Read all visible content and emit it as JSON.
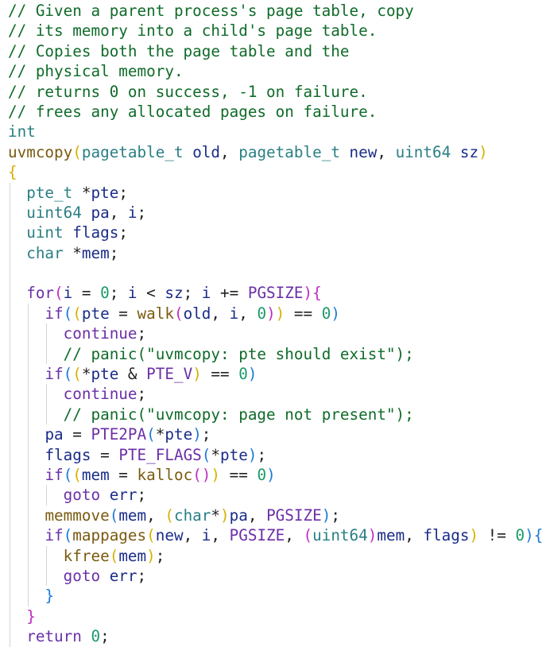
{
  "code": {
    "lines": [
      {
        "indent": 0,
        "guides": [],
        "tokens": [
          [
            "cm",
            "// Given a parent process's page table, copy"
          ]
        ]
      },
      {
        "indent": 0,
        "guides": [],
        "tokens": [
          [
            "cm",
            "// its memory into a child's page table."
          ]
        ]
      },
      {
        "indent": 0,
        "guides": [],
        "tokens": [
          [
            "cm",
            "// Copies both the page table and the"
          ]
        ]
      },
      {
        "indent": 0,
        "guides": [],
        "tokens": [
          [
            "cm",
            "// physical memory."
          ]
        ]
      },
      {
        "indent": 0,
        "guides": [],
        "tokens": [
          [
            "cm",
            "// returns 0 on success, -1 on failure."
          ]
        ]
      },
      {
        "indent": 0,
        "guides": [],
        "tokens": [
          [
            "cm",
            "// frees any allocated pages on failure."
          ]
        ]
      },
      {
        "indent": 0,
        "guides": [],
        "tokens": [
          [
            "ty",
            "int"
          ]
        ]
      },
      {
        "indent": 0,
        "guides": [],
        "tokens": [
          [
            "fn",
            "uvmcopy"
          ],
          [
            "b1",
            "("
          ],
          [
            "ty",
            "pagetable_t"
          ],
          [
            "op",
            " "
          ],
          [
            "var",
            "old"
          ],
          [
            "op",
            ", "
          ],
          [
            "ty",
            "pagetable_t"
          ],
          [
            "op",
            " "
          ],
          [
            "var",
            "new"
          ],
          [
            "op",
            ", "
          ],
          [
            "ty",
            "uint64"
          ],
          [
            "op",
            " "
          ],
          [
            "var",
            "sz"
          ],
          [
            "b1",
            ")"
          ]
        ]
      },
      {
        "indent": 0,
        "guides": [],
        "tokens": [
          [
            "b1",
            "{"
          ]
        ]
      },
      {
        "indent": 2,
        "guides": [
          0
        ],
        "tokens": [
          [
            "ty",
            "pte_t"
          ],
          [
            "op",
            " *"
          ],
          [
            "var",
            "pte"
          ],
          [
            "op",
            ";"
          ]
        ]
      },
      {
        "indent": 2,
        "guides": [
          0
        ],
        "tokens": [
          [
            "ty",
            "uint64"
          ],
          [
            "op",
            " "
          ],
          [
            "var",
            "pa"
          ],
          [
            "op",
            ", "
          ],
          [
            "var",
            "i"
          ],
          [
            "op",
            ";"
          ]
        ]
      },
      {
        "indent": 2,
        "guides": [
          0
        ],
        "tokens": [
          [
            "ty",
            "uint"
          ],
          [
            "op",
            " "
          ],
          [
            "var",
            "flags"
          ],
          [
            "op",
            ";"
          ]
        ]
      },
      {
        "indent": 2,
        "guides": [
          0
        ],
        "tokens": [
          [
            "ty",
            "char"
          ],
          [
            "op",
            " *"
          ],
          [
            "var",
            "mem"
          ],
          [
            "op",
            ";"
          ]
        ]
      },
      {
        "indent": 0,
        "guides": [
          0
        ],
        "tokens": []
      },
      {
        "indent": 2,
        "guides": [
          0
        ],
        "tokens": [
          [
            "kw",
            "for"
          ],
          [
            "b2",
            "("
          ],
          [
            "var",
            "i"
          ],
          [
            "op",
            " = "
          ],
          [
            "num",
            "0"
          ],
          [
            "op",
            "; "
          ],
          [
            "var",
            "i"
          ],
          [
            "op",
            " < "
          ],
          [
            "var",
            "sz"
          ],
          [
            "op",
            "; "
          ],
          [
            "var",
            "i"
          ],
          [
            "op",
            " += "
          ],
          [
            "mac",
            "PGSIZE"
          ],
          [
            "b2",
            ")"
          ],
          [
            "b2",
            "{"
          ]
        ]
      },
      {
        "indent": 4,
        "guides": [
          0,
          2
        ],
        "tokens": [
          [
            "kw",
            "if"
          ],
          [
            "b3",
            "("
          ],
          [
            "b1",
            "("
          ],
          [
            "var",
            "pte"
          ],
          [
            "op",
            " = "
          ],
          [
            "fn",
            "walk"
          ],
          [
            "b2",
            "("
          ],
          [
            "var",
            "old"
          ],
          [
            "op",
            ", "
          ],
          [
            "var",
            "i"
          ],
          [
            "op",
            ", "
          ],
          [
            "num",
            "0"
          ],
          [
            "b2",
            ")"
          ],
          [
            "b1",
            ")"
          ],
          [
            "op",
            " == "
          ],
          [
            "num",
            "0"
          ],
          [
            "b3",
            ")"
          ]
        ]
      },
      {
        "indent": 6,
        "guides": [
          0,
          2,
          4
        ],
        "tokens": [
          [
            "kw",
            "continue"
          ],
          [
            "op",
            ";"
          ]
        ]
      },
      {
        "indent": 6,
        "guides": [
          0,
          2,
          4
        ],
        "tokens": [
          [
            "cm",
            "// panic(\"uvmcopy: pte should exist\");"
          ]
        ]
      },
      {
        "indent": 4,
        "guides": [
          0,
          2
        ],
        "tokens": [
          [
            "kw",
            "if"
          ],
          [
            "b3",
            "("
          ],
          [
            "b1",
            "("
          ],
          [
            "op",
            "*"
          ],
          [
            "var",
            "pte"
          ],
          [
            "op",
            " & "
          ],
          [
            "mac",
            "PTE_V"
          ],
          [
            "b1",
            ")"
          ],
          [
            "op",
            " == "
          ],
          [
            "num",
            "0"
          ],
          [
            "b3",
            ")"
          ]
        ]
      },
      {
        "indent": 6,
        "guides": [
          0,
          2,
          4
        ],
        "tokens": [
          [
            "kw",
            "continue"
          ],
          [
            "op",
            ";"
          ]
        ]
      },
      {
        "indent": 6,
        "guides": [
          0,
          2,
          4
        ],
        "tokens": [
          [
            "cm",
            "// panic(\"uvmcopy: page not present\");"
          ]
        ]
      },
      {
        "indent": 4,
        "guides": [
          0,
          2
        ],
        "tokens": [
          [
            "var",
            "pa"
          ],
          [
            "op",
            " = "
          ],
          [
            "mac",
            "PTE2PA"
          ],
          [
            "b3",
            "("
          ],
          [
            "op",
            "*"
          ],
          [
            "var",
            "pte"
          ],
          [
            "b3",
            ")"
          ],
          [
            "op",
            ";"
          ]
        ]
      },
      {
        "indent": 4,
        "guides": [
          0,
          2
        ],
        "tokens": [
          [
            "var",
            "flags"
          ],
          [
            "op",
            " = "
          ],
          [
            "mac",
            "PTE_FLAGS"
          ],
          [
            "b3",
            "("
          ],
          [
            "op",
            "*"
          ],
          [
            "var",
            "pte"
          ],
          [
            "b3",
            ")"
          ],
          [
            "op",
            ";"
          ]
        ]
      },
      {
        "indent": 4,
        "guides": [
          0,
          2
        ],
        "tokens": [
          [
            "kw",
            "if"
          ],
          [
            "b3",
            "("
          ],
          [
            "b1",
            "("
          ],
          [
            "var",
            "mem"
          ],
          [
            "op",
            " = "
          ],
          [
            "fn",
            "kalloc"
          ],
          [
            "b2",
            "()"
          ],
          [
            "b1",
            ")"
          ],
          [
            "op",
            " == "
          ],
          [
            "num",
            "0"
          ],
          [
            "b3",
            ")"
          ]
        ]
      },
      {
        "indent": 6,
        "guides": [
          0,
          2,
          4
        ],
        "tokens": [
          [
            "kw",
            "goto"
          ],
          [
            "op",
            " "
          ],
          [
            "var",
            "err"
          ],
          [
            "op",
            ";"
          ]
        ]
      },
      {
        "indent": 4,
        "guides": [
          0,
          2
        ],
        "tokens": [
          [
            "fn",
            "memmove"
          ],
          [
            "b3",
            "("
          ],
          [
            "var",
            "mem"
          ],
          [
            "op",
            ", "
          ],
          [
            "b1",
            "("
          ],
          [
            "ty",
            "char"
          ],
          [
            "op",
            "*"
          ],
          [
            "b1",
            ")"
          ],
          [
            "var",
            "pa"
          ],
          [
            "op",
            ", "
          ],
          [
            "mac",
            "PGSIZE"
          ],
          [
            "b3",
            ")"
          ],
          [
            "op",
            ";"
          ]
        ]
      },
      {
        "indent": 4,
        "guides": [
          0,
          2
        ],
        "tokens": [
          [
            "kw",
            "if"
          ],
          [
            "b3",
            "("
          ],
          [
            "fn",
            "mappages"
          ],
          [
            "b1",
            "("
          ],
          [
            "var",
            "new"
          ],
          [
            "op",
            ", "
          ],
          [
            "var",
            "i"
          ],
          [
            "op",
            ", "
          ],
          [
            "mac",
            "PGSIZE"
          ],
          [
            "op",
            ", "
          ],
          [
            "b2",
            "("
          ],
          [
            "ty",
            "uint64"
          ],
          [
            "b2",
            ")"
          ],
          [
            "var",
            "mem"
          ],
          [
            "op",
            ", "
          ],
          [
            "var",
            "flags"
          ],
          [
            "b1",
            ")"
          ],
          [
            "op",
            " != "
          ],
          [
            "num",
            "0"
          ],
          [
            "b3",
            ")"
          ],
          [
            "b3",
            "{"
          ]
        ]
      },
      {
        "indent": 6,
        "guides": [
          0,
          2,
          4
        ],
        "tokens": [
          [
            "fn",
            "kfree"
          ],
          [
            "b1",
            "("
          ],
          [
            "var",
            "mem"
          ],
          [
            "b1",
            ")"
          ],
          [
            "op",
            ";"
          ]
        ]
      },
      {
        "indent": 6,
        "guides": [
          0,
          2,
          4
        ],
        "tokens": [
          [
            "kw",
            "goto"
          ],
          [
            "op",
            " "
          ],
          [
            "var",
            "err"
          ],
          [
            "op",
            ";"
          ]
        ]
      },
      {
        "indent": 4,
        "guides": [
          0,
          2
        ],
        "tokens": [
          [
            "b3",
            "}"
          ]
        ]
      },
      {
        "indent": 2,
        "guides": [
          0
        ],
        "tokens": [
          [
            "b2",
            "}"
          ]
        ]
      },
      {
        "indent": 2,
        "guides": [
          0
        ],
        "tokens": [
          [
            "kw",
            "return"
          ],
          [
            "op",
            " "
          ],
          [
            "num",
            "0"
          ],
          [
            "op",
            ";"
          ]
        ]
      }
    ]
  }
}
